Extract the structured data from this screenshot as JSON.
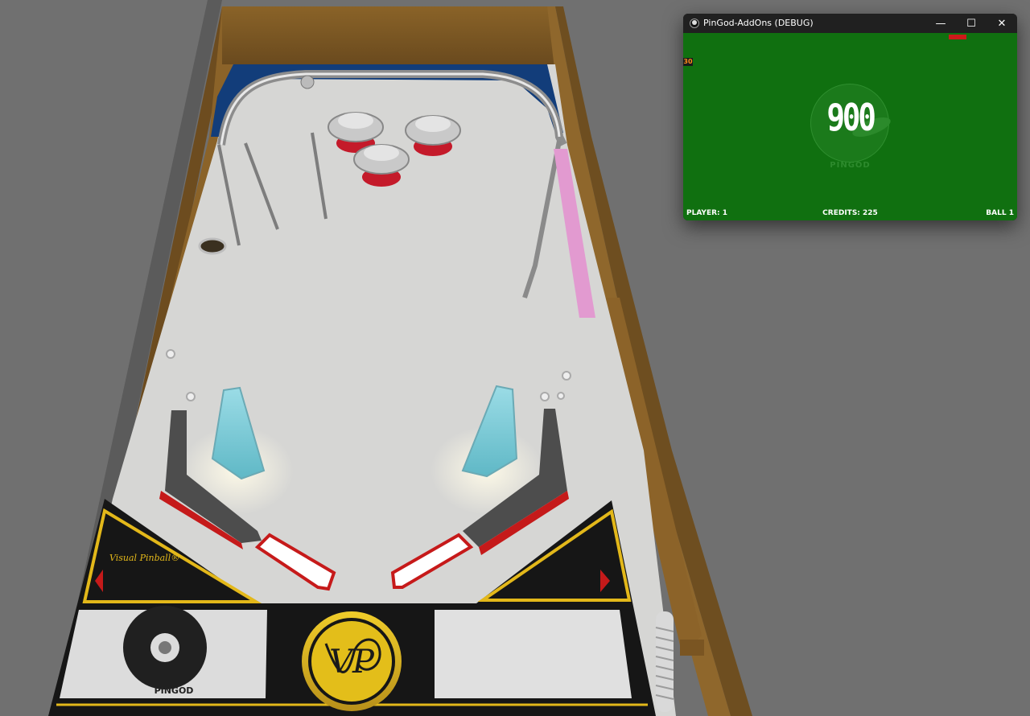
{
  "window": {
    "title": "PinGod-AddOns (DEBUG)",
    "icon": "pingod-app-icon",
    "minimize_glyph": "—",
    "maximize_glyph": "☐",
    "close_glyph": "✕"
  },
  "display": {
    "score": "900",
    "brand": "PINGOD",
    "corner_value": "30",
    "player": "PLAYER: 1",
    "credits": "CREDITS: 225",
    "ball": "BALL 1",
    "background_color": "#107010"
  },
  "playfield": {
    "apron_logo_text": "Visual Pinball",
    "apron_logo_mark": "®",
    "emblem_text": "VP",
    "left_card_text": "PINGOD"
  },
  "colors": {
    "wood": "#8a6428",
    "playfield": "#d8d8d6",
    "flipper_blue": "#7ad0e0",
    "apron_black": "#161616",
    "gold": "#e3b81a",
    "red": "#c01a1a"
  }
}
